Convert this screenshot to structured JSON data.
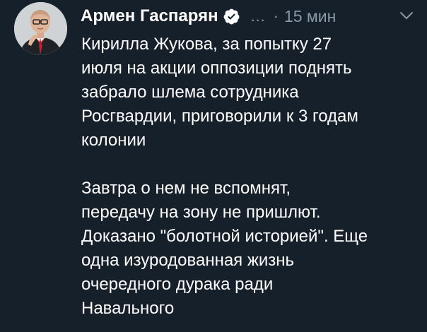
{
  "author": {
    "name": "Армен Гаспарян",
    "verified_icon": "verified-badge-icon"
  },
  "meta": {
    "ellipsis": "…",
    "separator": "·",
    "time": "15 мин"
  },
  "menu": {
    "icon": "chevron-down-icon"
  },
  "tweet": {
    "paragraphs": [
      {
        "lines": [
          "Кирилла Жукова, за попытку 27",
          "июля на акции оппозиции поднять",
          "забрало шлема сотрудника",
          "Росгвардии, приговорили к 3 годам",
          "колонии"
        ]
      },
      {
        "lines": [
          "Завтра о нем не вспомнят,",
          "передачу на зону не пришлют.",
          "Доказано \"болотной историей\". Еще",
          "одна изуродованная жизнь",
          "очередного дурака ради",
          "Навального"
        ]
      }
    ]
  },
  "colors": {
    "background": "#15202b",
    "text": "#ffffff",
    "secondary_text": "#8899a6"
  }
}
